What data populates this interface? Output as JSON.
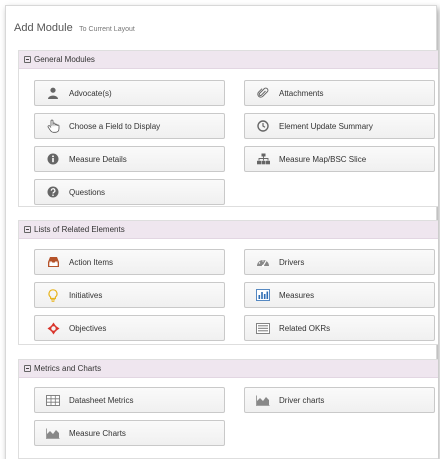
{
  "dialog": {
    "title": "Add Module",
    "subtitle": "To Current Layout"
  },
  "sections": {
    "general": {
      "title": "General Modules",
      "tiles": {
        "advocates": "Advocate(s)",
        "attachments": "Attachments",
        "choose_field": "Choose a Field to Display",
        "element_update_summary": "Element Update Summary",
        "measure_details": "Measure Details",
        "measure_map": "Measure Map/BSC Slice",
        "questions": "Questions"
      }
    },
    "related": {
      "title": "Lists of Related Elements",
      "tiles": {
        "action_items": "Action Items",
        "drivers": "Drivers",
        "initiatives": "Initiatives",
        "measures": "Measures",
        "objectives": "Objectives",
        "related_okrs": "Related OKRs"
      }
    },
    "metrics": {
      "title": "Metrics and Charts",
      "tiles": {
        "datasheet_metrics": "Datasheet Metrics",
        "driver_charts": "Driver charts",
        "measure_charts": "Measure Charts"
      }
    }
  },
  "colors": {
    "section_header_bg": "#efe6ef",
    "tile_border": "#c9c9c9",
    "objective_red": "#d9342b",
    "initiative_yellow": "#e8b520",
    "measures_blue": "#2e6db4",
    "action_items_brown": "#b5532a",
    "icon_gray": "#666666"
  }
}
